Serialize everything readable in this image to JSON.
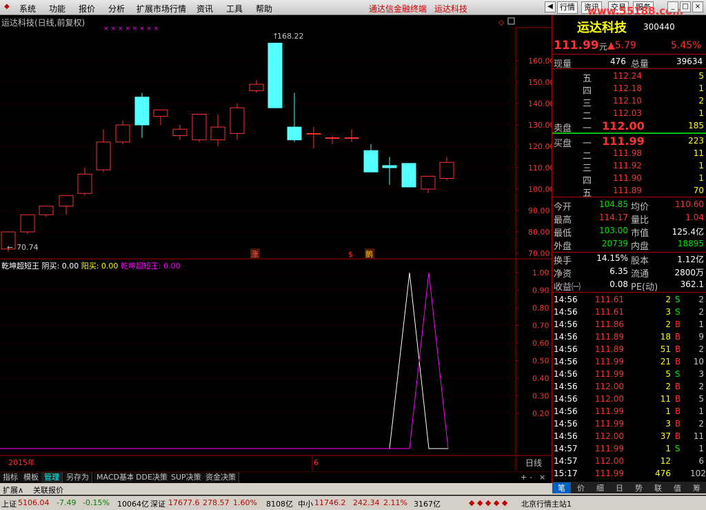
{
  "menu": {
    "items": [
      "系统",
      "功能",
      "报价",
      "分析",
      "扩展市场行情",
      "资讯",
      "工具",
      "帮助"
    ],
    "title_red": [
      "通达信金融终端",
      "运达科技"
    ],
    "buttons": [
      "行情",
      "资讯",
      "交易",
      "服务"
    ],
    "watermark": "www.55188.com"
  },
  "chart": {
    "title": "运达科技(日线,前复权)",
    "high_label": "168.22",
    "low_label": "70.74",
    "markers": [
      "涨",
      "$",
      "鹅"
    ],
    "axis_labels": [
      "160.00",
      "150.00",
      "140.00",
      "130.00",
      "120.00",
      "110.00",
      "100.00",
      "90.00",
      "80.00",
      "70.00"
    ],
    "x_labels": [
      "2015年",
      "6",
      "日线"
    ]
  },
  "chart_data": {
    "type": "candlestick",
    "x": [
      "d1",
      "d2",
      "d3",
      "d4",
      "d5",
      "d6",
      "d7",
      "d8",
      "d9",
      "d10",
      "d11",
      "d12",
      "d13",
      "d14",
      "d15",
      "d16",
      "d17",
      "d18",
      "d19",
      "d20",
      "d21",
      "d22",
      "d23",
      "d24"
    ],
    "ohlc": [
      [
        72,
        80,
        70.74,
        80
      ],
      [
        80,
        88,
        79,
        88
      ],
      [
        88,
        92,
        87,
        92
      ],
      [
        92,
        97,
        88,
        97
      ],
      [
        98,
        110,
        97,
        107
      ],
      [
        109,
        128,
        108,
        122
      ],
      [
        122,
        132,
        121,
        130
      ],
      [
        143,
        145,
        124,
        130
      ],
      [
        134,
        137,
        130,
        137
      ],
      [
        125,
        130,
        123,
        128
      ],
      [
        123,
        135,
        122,
        135
      ],
      [
        123,
        135,
        120,
        129
      ],
      [
        126,
        140,
        123,
        138
      ],
      [
        146,
        151,
        145,
        149
      ],
      [
        168.22,
        168.22,
        138,
        138
      ],
      [
        129,
        145,
        122,
        123
      ],
      [
        126,
        129,
        119,
        126
      ],
      [
        124,
        125,
        121,
        124
      ],
      [
        124,
        128,
        122,
        124
      ],
      [
        118,
        121,
        109,
        108
      ],
      [
        111,
        115,
        102,
        110
      ],
      [
        112,
        112,
        101,
        101
      ],
      [
        100,
        106,
        98,
        106
      ],
      [
        105,
        115,
        104,
        112.5
      ]
    ],
    "ylim": [
      70,
      170
    ]
  },
  "indicator": {
    "name": "乾坤超短王",
    "items": [
      {
        "label": "阴买: ",
        "value": "0.00"
      },
      {
        "label": "阳买: ",
        "value": "0.00"
      },
      {
        "label": "乾坤超短王: ",
        "value": "0.00"
      }
    ],
    "axis_labels": [
      "1.00",
      "0.90",
      "0.80",
      "0.70",
      "0.60",
      "0.50",
      "0.40",
      "0.30",
      "0.20"
    ],
    "series": [
      {
        "points": [
          [
            0,
            0
          ],
          [
            565,
            0
          ],
          [
            594,
            1
          ],
          [
            622,
            0
          ],
          [
            650,
            0
          ]
        ],
        "color": "#ffffff"
      },
      {
        "points": [
          [
            0,
            0
          ],
          [
            594,
            0
          ],
          [
            622,
            1
          ],
          [
            650,
            0
          ]
        ],
        "color": "#ff00ff"
      }
    ]
  },
  "bottom_tabs": [
    "指标",
    "模板",
    "管理",
    "另存为",
    "MACD基本",
    "DDE决策",
    "SUP决策",
    "资金决策"
  ],
  "ext_bar": [
    "扩展∧",
    "关联报价"
  ],
  "quote": {
    "name": "运达科技",
    "code": "300440",
    "price": "111.99",
    "unit": "元",
    "change": "▲5.79",
    "pct": "5.45%",
    "xianliang_label": "现量",
    "xianliang": "476",
    "zongliang_label": "总量",
    "zongliang": "39634",
    "asks": [
      {
        "l": "五",
        "p": "112.24",
        "v": "5"
      },
      {
        "l": "四",
        "p": "112.18",
        "v": "1"
      },
      {
        "l": "三",
        "p": "112.10",
        "v": "2"
      },
      {
        "l": "二",
        "p": "112.03",
        "v": "1"
      },
      {
        "l": "一",
        "p": "112.00",
        "v": "185"
      }
    ],
    "ask_label": "卖盘",
    "bid_label": "买盘",
    "bids": [
      {
        "l": "一",
        "p": "111.99",
        "v": "223"
      },
      {
        "l": "二",
        "p": "111.98",
        "v": "11"
      },
      {
        "l": "三",
        "p": "111.92",
        "v": "1"
      },
      {
        "l": "四",
        "p": "111.90",
        "v": "1"
      },
      {
        "l": "五",
        "p": "111.89",
        "v": "70"
      }
    ],
    "stats": [
      [
        "今开",
        "104.85",
        "均价",
        "110.60"
      ],
      [
        "最高",
        "114.17",
        "量比",
        "1.04"
      ],
      [
        "最低",
        "103.00",
        "市值",
        "125.4亿"
      ],
      [
        "外盘",
        "20739",
        "内盘",
        "18895"
      ],
      [
        "换手",
        "14.15%",
        "股本",
        "1.12亿"
      ],
      [
        "净资",
        "6.35",
        "流通",
        "2800万"
      ],
      [
        "收益㈠",
        "0.08",
        "PE(动)",
        "362.1"
      ]
    ],
    "ticks": [
      [
        "14:56",
        "111.61",
        "2",
        "S",
        "2"
      ],
      [
        "14:56",
        "111.61",
        "3",
        "S",
        "2"
      ],
      [
        "14:56",
        "111.86",
        "2",
        "B",
        "1"
      ],
      [
        "14:56",
        "111.89",
        "18",
        "B",
        "9"
      ],
      [
        "14:56",
        "111.89",
        "51",
        "B",
        "2"
      ],
      [
        "14:56",
        "111.99",
        "21",
        "B",
        "10"
      ],
      [
        "14:56",
        "111.99",
        "5",
        "S",
        "3"
      ],
      [
        "14:56",
        "112.00",
        "2",
        "B",
        "2"
      ],
      [
        "14:56",
        "112.00",
        "11",
        "B",
        "5"
      ],
      [
        "14:56",
        "111.99",
        "1",
        "B",
        "1"
      ],
      [
        "14:56",
        "111.99",
        "3",
        "B",
        "2"
      ],
      [
        "14:56",
        "112.00",
        "37",
        "B",
        "11"
      ],
      [
        "14:57",
        "111.99",
        "1",
        "S",
        "1"
      ],
      [
        "14:57",
        "112.00",
        "12",
        "",
        "6"
      ],
      [
        "15:17",
        "111.99",
        "476",
        "",
        "102"
      ]
    ],
    "rtabs": [
      "笔",
      "价",
      "细",
      "日",
      "势",
      "联",
      "值",
      "筹"
    ]
  },
  "status": {
    "sh": "上证",
    "sh_v": "5106.04",
    "sh_c": "-7.49",
    "sh_p": "-0.15%",
    "sh_a": "10064亿",
    "sz": "深证",
    "sz_v": "17677.6",
    "sz_c": "278.57",
    "sz_p": "1.60%",
    "sz_a": "8108亿",
    "zx": "中小",
    "zx_v": "11746.2",
    "zx_c": "242.34",
    "zx_p": "2.11%",
    "zx_a": "3167亿",
    "station": "北京行情主站1"
  }
}
